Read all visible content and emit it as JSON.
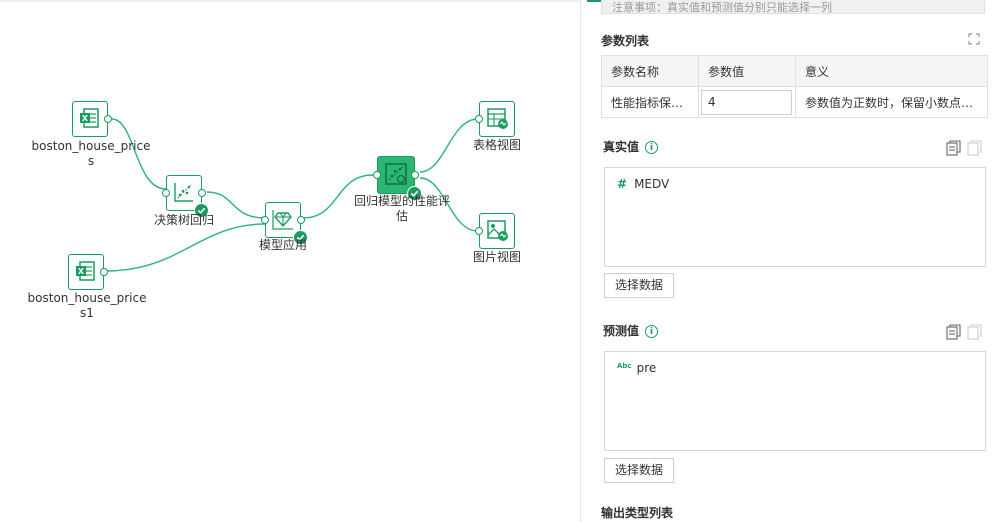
{
  "canvas": {
    "nodes": {
      "boston1": {
        "label": "boston_house_price s",
        "icon": "excel-icon"
      },
      "boston2": {
        "label": "boston_house_price s1",
        "icon": "excel-icon"
      },
      "tree": {
        "label": "决策树回归",
        "icon": "scatter-trend-icon"
      },
      "apply": {
        "label": "模型应用",
        "icon": "model-apply-icon"
      },
      "eval": {
        "label": "回归模型的性能评估",
        "icon": "regression-eval-icon"
      },
      "table": {
        "label": "表格视图",
        "icon": "table-view-icon"
      },
      "image": {
        "label": "图片视图",
        "icon": "image-view-icon"
      }
    }
  },
  "panel": {
    "note": "注意事项：真实值和预测值分别只能选择一列",
    "params_title": "参数列表",
    "params_table": {
      "headers": [
        "参数名称",
        "参数值",
        "意义"
      ],
      "rows": [
        {
          "name": "性能指标保留...",
          "value": "4",
          "meaning": "参数值为正数时，保留小数点后..."
        }
      ]
    },
    "actual": {
      "title": "真实值",
      "field_type": "#",
      "field_name": "MEDV",
      "select_label": "选择数据"
    },
    "predicted": {
      "title": "预测值",
      "field_type": "Abc",
      "field_name": "pre",
      "select_label": "选择数据"
    },
    "output_title": "输出类型列表"
  },
  "colors": {
    "accent": "#1a9c60",
    "selected_node": "#2bb673",
    "edge": "#2bb673"
  }
}
